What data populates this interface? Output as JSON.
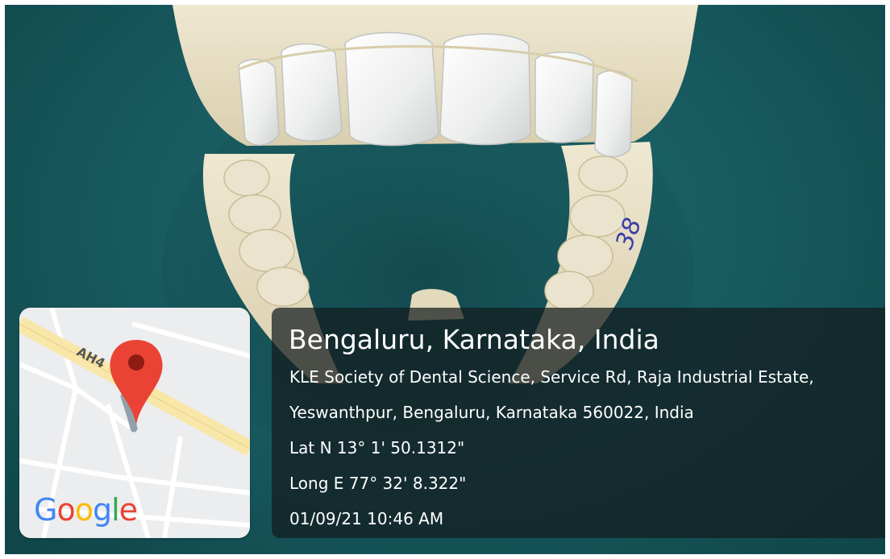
{
  "photo": {
    "subject": "dental-cast-model",
    "model_marking": "38"
  },
  "map": {
    "road_label": "AH4",
    "logo": {
      "letters": [
        "G",
        "o",
        "o",
        "g",
        "l",
        "e"
      ],
      "colors": [
        "#4285F4",
        "#EA4335",
        "#FBBC05",
        "#4285F4",
        "#34A853",
        "#EA4335"
      ]
    },
    "pin_color": "#EA4335"
  },
  "location": {
    "title": "Bengaluru, Karnataka, India",
    "address_line1": "KLE Society of Dental Science, Service Rd, Raja Industrial Estate,",
    "address_line2": "Yeswanthpur, Bengaluru, Karnataka 560022, India",
    "latitude": "Lat N 13° 1' 50.1312\"",
    "longitude": "Long E 77° 32' 8.322\"",
    "timestamp": "01/09/21 10:46 AM"
  },
  "colors": {
    "background": "#17585d",
    "cast": "#e9e1c8",
    "tooth": "#f1f1ee"
  }
}
